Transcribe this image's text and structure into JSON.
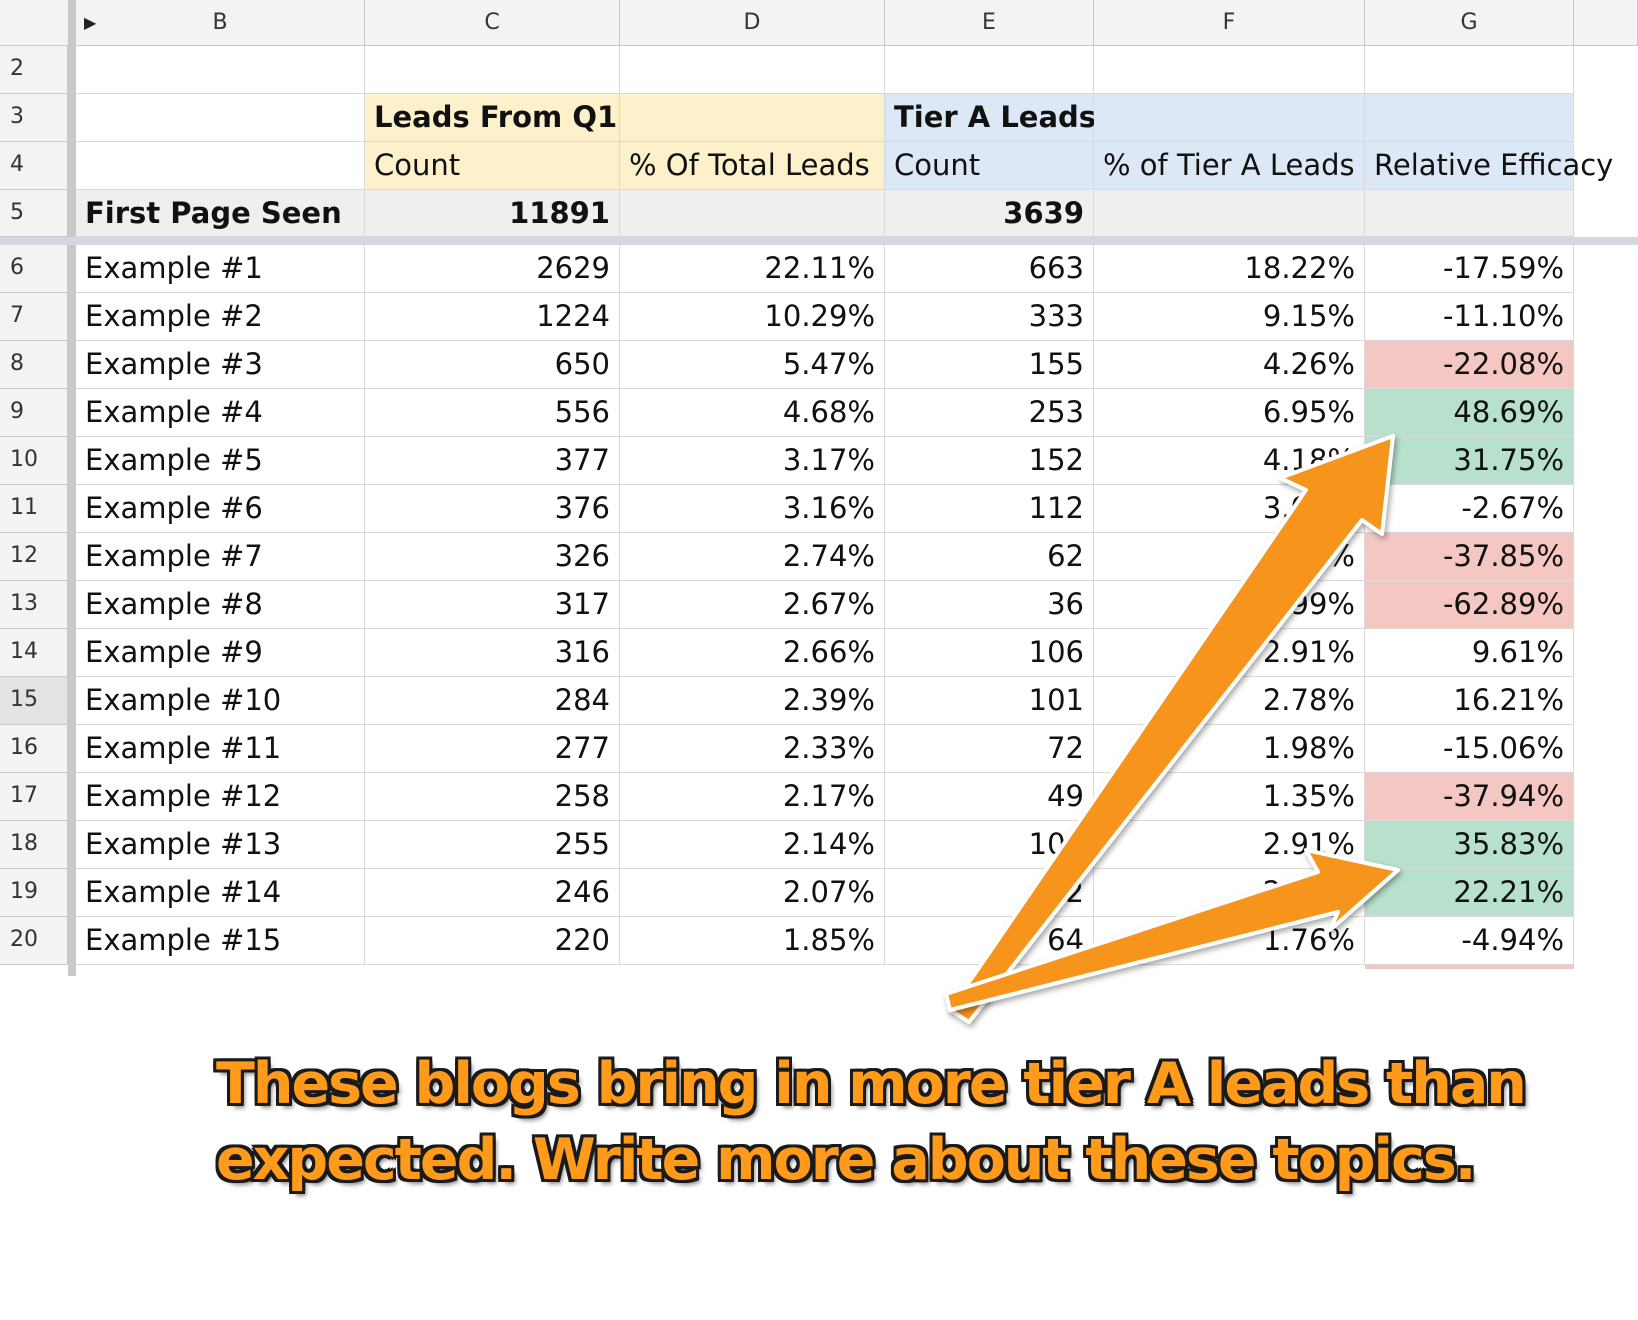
{
  "columns": [
    "B",
    "C",
    "D",
    "E",
    "F",
    "G"
  ],
  "row_numbers": [
    "2",
    "3",
    "4",
    "5",
    "6",
    "7",
    "8",
    "9",
    "10",
    "11",
    "12",
    "13",
    "14",
    "15",
    "16",
    "17",
    "18",
    "19",
    "20"
  ],
  "header": {
    "leads_group": "Leads From Q1",
    "tier_group": "Tier A Leads",
    "count_label": "Count",
    "pct_total_label": "% Of Total Leads",
    "tier_count_label": "Count",
    "pct_tier_label": "% of Tier A Leads",
    "efficacy_label": "Relative Efficacy"
  },
  "totals": {
    "label": "First Page Seen",
    "count": "11891",
    "tier_count": "3639"
  },
  "rows": [
    {
      "name": "Example #1",
      "count": "2629",
      "pct_total": "22.11%",
      "tier_count": "663",
      "pct_tier": "18.22%",
      "efficacy": "-17.59%",
      "highlight": "none"
    },
    {
      "name": "Example #2",
      "count": "1224",
      "pct_total": "10.29%",
      "tier_count": "333",
      "pct_tier": "9.15%",
      "efficacy": "-11.10%",
      "highlight": "none"
    },
    {
      "name": "Example #3",
      "count": "650",
      "pct_total": "5.47%",
      "tier_count": "155",
      "pct_tier": "4.26%",
      "efficacy": "-22.08%",
      "highlight": "red"
    },
    {
      "name": "Example #4",
      "count": "556",
      "pct_total": "4.68%",
      "tier_count": "253",
      "pct_tier": "6.95%",
      "efficacy": "48.69%",
      "highlight": "green"
    },
    {
      "name": "Example #5",
      "count": "377",
      "pct_total": "3.17%",
      "tier_count": "152",
      "pct_tier": "4.18%",
      "efficacy": "31.75%",
      "highlight": "green"
    },
    {
      "name": "Example #6",
      "count": "376",
      "pct_total": "3.16%",
      "tier_count": "112",
      "pct_tier": "3.08%",
      "efficacy": "-2.67%",
      "highlight": "none"
    },
    {
      "name": "Example #7",
      "count": "326",
      "pct_total": "2.74%",
      "tier_count": "62",
      "pct_tier": "1.70%",
      "efficacy": "-37.85%",
      "highlight": "red"
    },
    {
      "name": "Example #8",
      "count": "317",
      "pct_total": "2.67%",
      "tier_count": "36",
      "pct_tier": "0.99%",
      "efficacy": "-62.89%",
      "highlight": "red"
    },
    {
      "name": "Example #9",
      "count": "316",
      "pct_total": "2.66%",
      "tier_count": "106",
      "pct_tier": "2.91%",
      "efficacy": "9.61%",
      "highlight": "none"
    },
    {
      "name": "Example #10",
      "count": "284",
      "pct_total": "2.39%",
      "tier_count": "101",
      "pct_tier": "2.78%",
      "efficacy": "16.21%",
      "highlight": "none"
    },
    {
      "name": "Example #11",
      "count": "277",
      "pct_total": "2.33%",
      "tier_count": "72",
      "pct_tier": "1.98%",
      "efficacy": "-15.06%",
      "highlight": "none"
    },
    {
      "name": "Example #12",
      "count": "258",
      "pct_total": "2.17%",
      "tier_count": "49",
      "pct_tier": "1.35%",
      "efficacy": "-37.94%",
      "highlight": "red"
    },
    {
      "name": "Example #13",
      "count": "255",
      "pct_total": "2.14%",
      "tier_count": "106",
      "pct_tier": "2.91%",
      "efficacy": "35.83%",
      "highlight": "green"
    },
    {
      "name": "Example #14",
      "count": "246",
      "pct_total": "2.07%",
      "tier_count": "92",
      "pct_tier": "2.53%",
      "efficacy": "22.21%",
      "highlight": "green"
    },
    {
      "name": "Example #15",
      "count": "220",
      "pct_total": "1.85%",
      "tier_count": "64",
      "pct_tier": "1.76%",
      "efficacy": "-4.94%",
      "highlight": "none"
    }
  ],
  "colors": {
    "leads_header_bg": "#fdf1cc",
    "tier_header_bg": "#dce8f5",
    "totals_bg": "#efefef",
    "positive_bg": "#b7e1cd",
    "negative_bg": "#f4c7c3",
    "arrow": "#f7941d"
  },
  "caption": {
    "line1": "These blogs bring in more tier A leads than",
    "line2": "expected. Write more about these topics."
  }
}
